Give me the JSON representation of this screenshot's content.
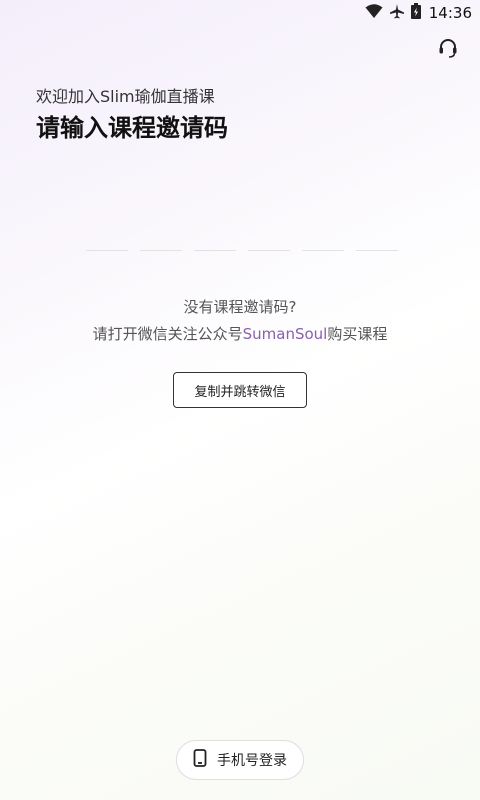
{
  "status_bar": {
    "time": "14:36",
    "icons": [
      "wifi-icon",
      "airplane-icon",
      "battery-icon"
    ]
  },
  "header": {
    "support_icon": "headset-icon"
  },
  "main": {
    "welcome": "欢迎加入Slim瑜伽直播课",
    "title": "请输入课程邀请码",
    "code_slots": 6,
    "hint_line1": "没有课程邀请码?",
    "hint_line2_prefix": "请打开微信关注公众号",
    "hint_line2_brand": "SumanSoul",
    "hint_line2_suffix": "购买课程",
    "copy_button_label": "复制并跳转微信"
  },
  "footer": {
    "phone_login_label": "手机号登录",
    "phone_icon": "phone-icon"
  },
  "colors": {
    "brand_accent": "#8a5fb0",
    "text_primary": "#111111",
    "text_secondary": "#555555"
  }
}
